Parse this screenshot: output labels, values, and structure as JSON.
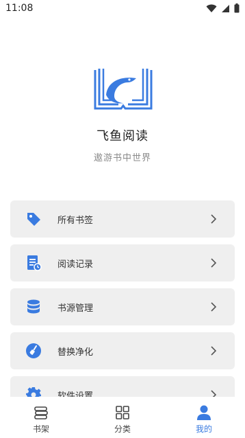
{
  "status_bar": {
    "time": "11:08",
    "icons": [
      "wifi-icon",
      "signal-icon",
      "battery-icon"
    ]
  },
  "profile": {
    "app_name": "飞鱼阅读",
    "slogan": "遨游书中世界",
    "logo_icon": "book-fish-logo"
  },
  "menu": {
    "items": [
      {
        "label": "所有书签",
        "icon": "tag-icon"
      },
      {
        "label": "阅读记录",
        "icon": "reading-record-icon"
      },
      {
        "label": "书源管理",
        "icon": "database-icon"
      },
      {
        "label": "替换净化",
        "icon": "broom-icon"
      },
      {
        "label": "软件设置",
        "icon": "gear-icon"
      }
    ]
  },
  "tabbar": {
    "tabs": [
      {
        "label": "书架",
        "icon": "bookshelf-icon",
        "active": false
      },
      {
        "label": "分类",
        "icon": "grid-icon",
        "active": false
      },
      {
        "label": "我的",
        "icon": "person-icon",
        "active": true
      }
    ]
  },
  "colors": {
    "accent": "#3a7be0",
    "menu_bg": "#efefef",
    "text": "#333333",
    "muted": "#8a8a8a"
  }
}
